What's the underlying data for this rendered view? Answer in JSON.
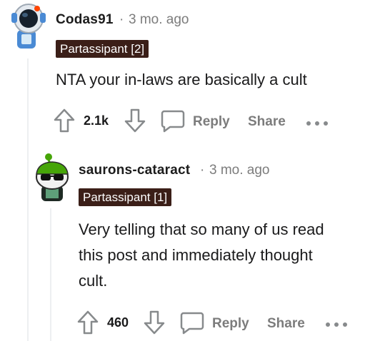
{
  "comments": [
    {
      "username": "Codas91",
      "separator": "·",
      "timestamp": "3 mo. ago",
      "flair": "Partassipant [2]",
      "body": "NTA your in-laws are basically a cult",
      "score": "2.1k",
      "reply_label": "Reply",
      "share_label": "Share"
    },
    {
      "username": "saurons-cataract",
      "separator": "·",
      "timestamp": "3 mo. ago",
      "flair": "Partassipant [1]",
      "body_lines": [
        "Very telling that so many of us read",
        "this post and immediately thought",
        "cult."
      ],
      "score": "460",
      "reply_label": "Reply",
      "share_label": "Share"
    }
  ],
  "colors": {
    "flair_bg": "#3b1f18",
    "muted": "#7c7c7c",
    "thread_line": "#edeff1"
  },
  "icons": {
    "upvote": "arrow-up-icon",
    "downvote": "arrow-down-icon",
    "reply": "speech-bubble-icon",
    "more": "ellipsis-icon"
  }
}
